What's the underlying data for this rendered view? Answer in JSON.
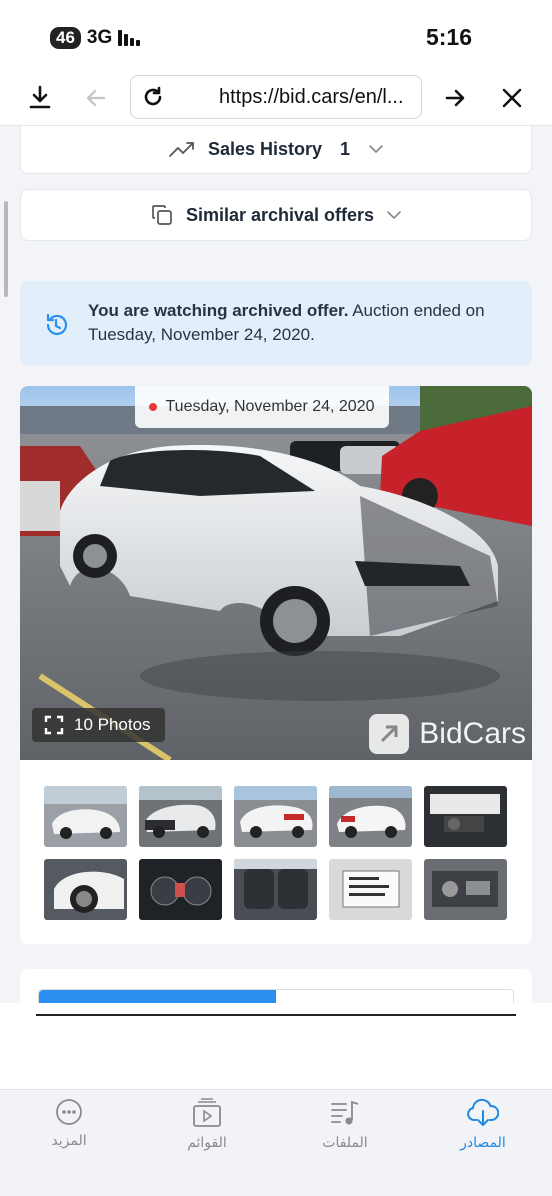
{
  "status_bar": {
    "network_badge": "46",
    "network_type": "3G",
    "time": "5:16"
  },
  "browser": {
    "url": "https://bid.cars/en/l...",
    "icons": [
      "download-icon",
      "back-arrow-icon",
      "reload-icon",
      "forward-arrow-icon",
      "close-icon"
    ]
  },
  "sales_history": {
    "label": "Sales History",
    "count": "1"
  },
  "similar_offers": {
    "label": "Similar archival offers"
  },
  "notice": {
    "bold": "You are watching archived offer.",
    "rest": " Auction ended on Tuesday, November 24, 2020."
  },
  "photo": {
    "date": "Tuesday, November 24, 2020",
    "photos_label": "10 Photos",
    "watermark": "BidCars"
  },
  "progress": {
    "fraction": 0.5
  },
  "tabbar": {
    "tabs": [
      {
        "label": "المزيد",
        "icon": "more-icon"
      },
      {
        "label": "القوائم",
        "icon": "playlist-icon"
      },
      {
        "label": "الملفات",
        "icon": "music-files-icon"
      },
      {
        "label": "المصادر",
        "icon": "cloud-download-icon",
        "active": true
      }
    ]
  },
  "colors": {
    "accent": "#1e88e5",
    "progress": "#2a8ff0",
    "notice_bg": "#e3eefb"
  }
}
